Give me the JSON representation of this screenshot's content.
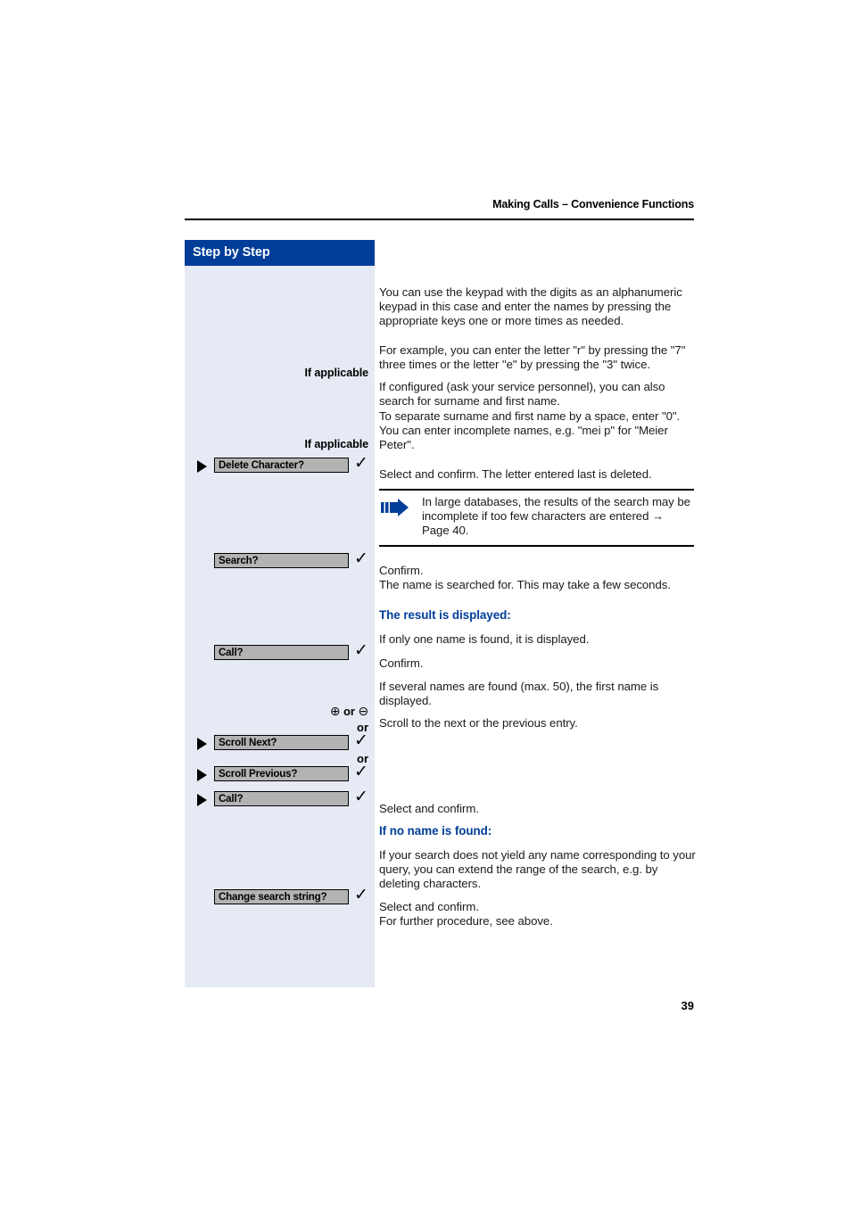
{
  "header": {
    "running_title": "Making Calls – Convenience Functions"
  },
  "sidebar": {
    "title": "Step by Step",
    "rows": [
      {
        "type": "label",
        "text": "If applicable"
      },
      {
        "type": "label",
        "text": "If applicable"
      },
      {
        "type": "button",
        "text": "Delete Character?",
        "triangle": true,
        "check": "✓"
      },
      {
        "type": "button",
        "text": "Search?",
        "triangle": false,
        "check": "✓"
      },
      {
        "type": "button",
        "text": "Call?",
        "triangle": false,
        "check": "✓"
      },
      {
        "type": "rocker",
        "plus": "⊕",
        "or": "or",
        "minus": "⊖"
      },
      {
        "type": "or",
        "text": "or"
      },
      {
        "type": "button",
        "text": "Scroll Next?",
        "triangle": true,
        "check": "✓"
      },
      {
        "type": "or",
        "text": "or"
      },
      {
        "type": "button",
        "text": "Scroll Previous?",
        "triangle": true,
        "check": "✓"
      },
      {
        "type": "button",
        "text": "Call?",
        "triangle": true,
        "check": "✓"
      },
      {
        "type": "button",
        "text": "Change search string?",
        "triangle": false,
        "check": "✓"
      }
    ],
    "labels": {
      "if_applicable_1": "If applicable",
      "if_applicable_2": "If applicable",
      "delete_character": "Delete Character?",
      "search": "Search?",
      "call_1": "Call?",
      "rocker_plus": "⊕",
      "rocker_or": "or",
      "rocker_minus": "⊖",
      "or_1": "or",
      "scroll_next": "Scroll Next?",
      "or_2": "or",
      "scroll_previous": "Scroll Previous?",
      "call_2": "Call?",
      "change_search_string": "Change search string?",
      "check_mark": "✓"
    }
  },
  "content": {
    "p1": "You can use the keypad with the digits as an alphanumeric keypad in this case and enter the names by pressing the appropriate keys one or more times as needed.",
    "p2": "For example, you can enter the letter \"r\" by pressing the \"7\" three times or the letter \"e\" by pressing the \"3\" twice.",
    "p3": "If configured (ask your service personnel), you can also search for surname and first name.",
    "p4": "To separate surname and first name by a space, enter \"0\". You can enter incomplete names, e.g. \"mei p\" for \"Meier Peter\".",
    "p5": "Select and confirm. The letter entered last is deleted.",
    "note": "In large databases, the results of the search may be incomplete if too few characters are entered → Page 40.",
    "p6": "Confirm.",
    "p7": "The name is searched for. This may take a few seconds.",
    "h1": "The result is displayed:",
    "p8": "If only one name is found, it is displayed.",
    "p9": "Confirm.",
    "p10": "If several names are found (max. 50), the first name is displayed.",
    "p11": "Scroll to the next or the previous entry.",
    "p12": "Select and confirm.",
    "h2": "If no name is found:",
    "p13": "If your search does not yield any name corresponding to your query, you can extend the range of the search, e.g. by deleting characters.",
    "p14": "Select and confirm.",
    "p15": "For further procedure, see above."
  },
  "footer": {
    "page_number": "39"
  },
  "colors": {
    "brand_blue": "#003d99",
    "sidebar_bg": "#e6eaf4",
    "button_gray": "#b3b3b3"
  }
}
